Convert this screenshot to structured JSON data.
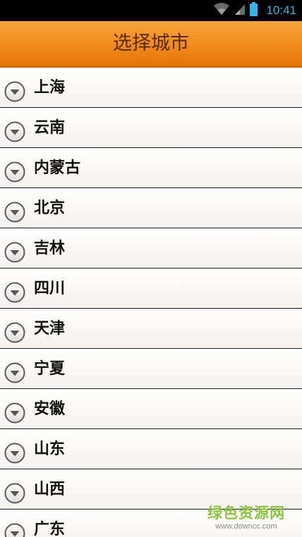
{
  "status_bar": {
    "time": "10:41",
    "icons": [
      "wifi-icon",
      "signal-icon",
      "battery-icon"
    ],
    "accent_color": "#33b5e5"
  },
  "header": {
    "title": "选择城市",
    "background_color": "#ef8a18"
  },
  "city_list": {
    "icon": "chevron-down-circle-icon",
    "items": [
      {
        "label": "上海"
      },
      {
        "label": "云南"
      },
      {
        "label": "内蒙古"
      },
      {
        "label": "北京"
      },
      {
        "label": "吉林"
      },
      {
        "label": "四川"
      },
      {
        "label": "天津"
      },
      {
        "label": "宁夏"
      },
      {
        "label": "安徽"
      },
      {
        "label": "山东"
      },
      {
        "label": "山西"
      },
      {
        "label": "广东"
      }
    ]
  },
  "watermark": {
    "title": "绿色资源网",
    "url": "www.downcc.com"
  }
}
